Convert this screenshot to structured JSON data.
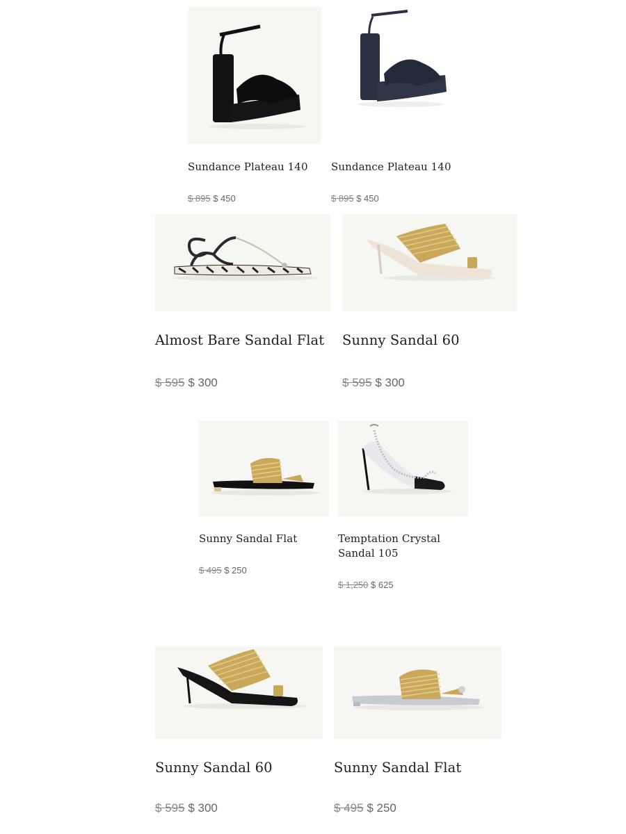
{
  "currency": "$",
  "products": [
    {
      "name": "Sundance Plateau 140",
      "price_original": "895",
      "price_sale": "450",
      "image": "black-platform-sandal",
      "shoe_color": "#111111"
    },
    {
      "name": "Sundance Plateau 140",
      "price_original": "895",
      "price_sale": "450",
      "image": "navy-platform-sandal",
      "shoe_color": "#2b3042"
    },
    {
      "name": "Almost Bare Sandal Flat",
      "price_original": "595",
      "price_sale": "300",
      "image": "zebra-flat-sandal",
      "shoe_color": "#2a2a2a"
    },
    {
      "name": "Sunny Sandal 60",
      "price_original": "595",
      "price_sale": "300",
      "image": "gold-mule-60-nude",
      "shoe_color": "#c9a85a"
    },
    {
      "name": "Sunny Sandal Flat",
      "price_original": "495",
      "price_sale": "250",
      "image": "gold-flat-black-sole",
      "shoe_color": "#c9a85a"
    },
    {
      "name": "Temptation Crystal Sandal 105",
      "price_original": "1,250",
      "price_sale": "625",
      "image": "crystal-pvc-heel",
      "shoe_color": "#1a1a1a"
    },
    {
      "name": "Sunny Sandal 60",
      "price_original": "595",
      "price_sale": "300",
      "image": "gold-mule-60-black",
      "shoe_color": "#c9a85a"
    },
    {
      "name": "Sunny Sandal Flat",
      "price_original": "495",
      "price_sale": "250",
      "image": "gold-flat-silver-sole",
      "shoe_color": "#c9a85a"
    }
  ]
}
